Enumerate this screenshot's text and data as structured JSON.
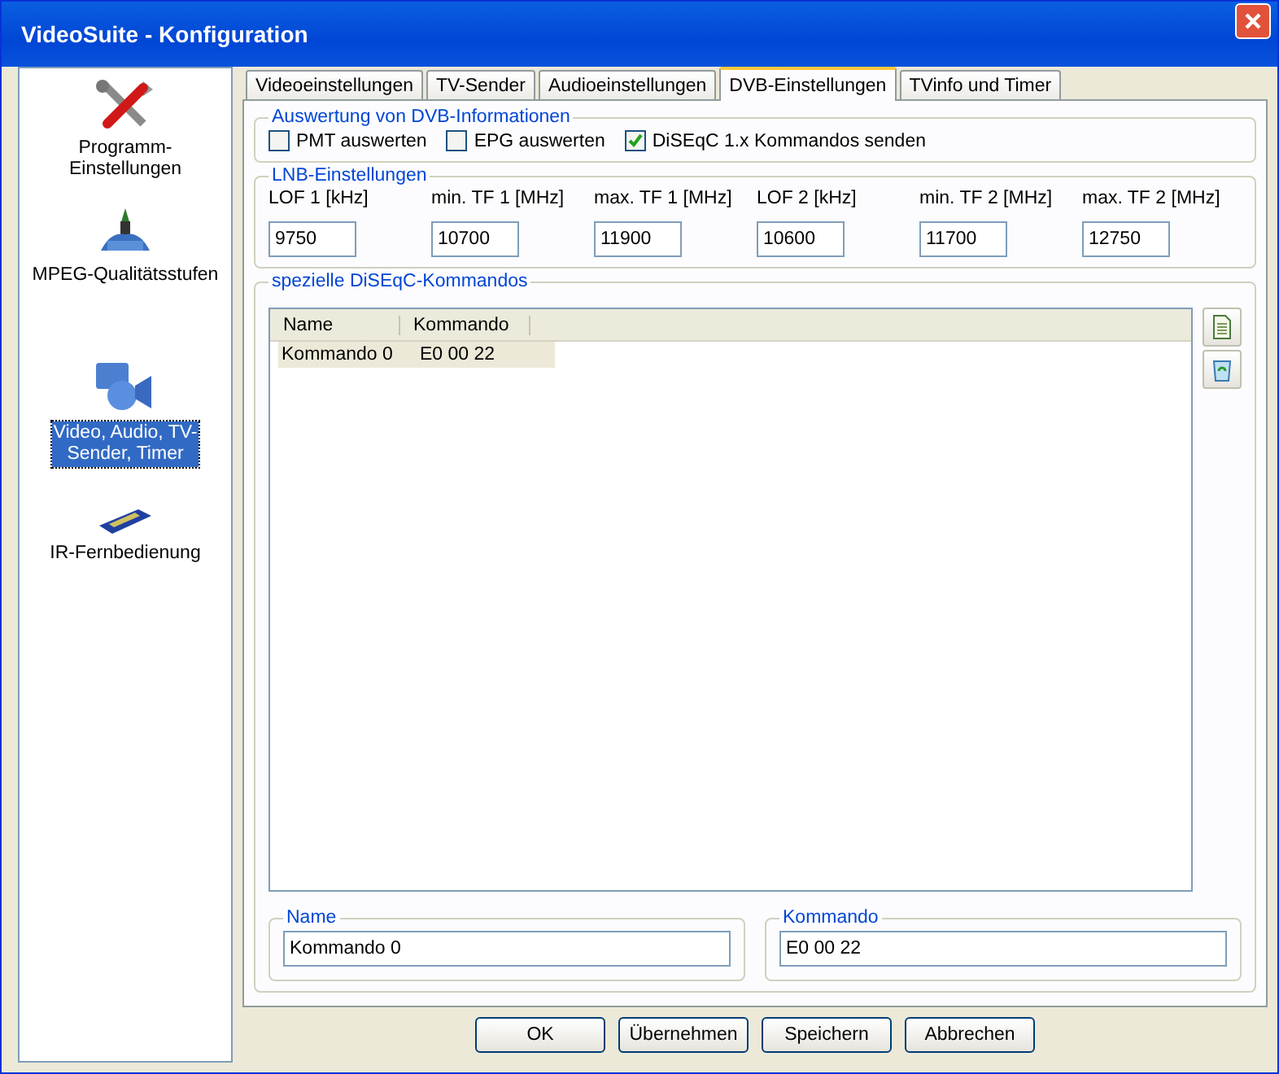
{
  "window": {
    "title": "VideoSuite - Konfiguration"
  },
  "sidebar": {
    "items": [
      {
        "label": "Programm-Einstellungen",
        "kind": "tools",
        "selected": false
      },
      {
        "label": "MPEG-Qualitätsstufen",
        "kind": "mpeg",
        "selected": false
      },
      {
        "label": "Video, Audio, TV-Sender, Timer",
        "kind": "media",
        "selected": true
      },
      {
        "label": "IR-Fernbedienung",
        "kind": "remote",
        "selected": false
      }
    ]
  },
  "tabs": [
    {
      "label": "Videoeinstellungen",
      "selected": false
    },
    {
      "label": "TV-Sender",
      "selected": false
    },
    {
      "label": "Audioeinstellungen",
      "selected": false
    },
    {
      "label": "DVB-Einstellungen",
      "selected": true
    },
    {
      "label": "TVinfo und Timer",
      "selected": false
    }
  ],
  "dvb_info": {
    "title": "Auswertung von DVB-Informationen",
    "checkboxes": [
      {
        "label": "PMT auswerten",
        "checked": false
      },
      {
        "label": "EPG auswerten",
        "checked": false
      },
      {
        "label": "DiSEqC 1.x Kommandos senden",
        "checked": true
      }
    ]
  },
  "lnb": {
    "title": "LNB-Einstellungen",
    "fields": [
      {
        "label": "LOF 1 [kHz]",
        "value": "9750"
      },
      {
        "label": "min. TF 1 [MHz]",
        "value": "10700"
      },
      {
        "label": "max. TF 1 [MHz]",
        "value": "11900"
      },
      {
        "label": "LOF 2 [kHz]",
        "value": "10600"
      },
      {
        "label": "min. TF 2 [MHz]",
        "value": "11700"
      },
      {
        "label": "max. TF 2 [MHz]",
        "value": "12750"
      }
    ]
  },
  "diseqc": {
    "title": "spezielle DiSEqC-Kommandos",
    "columns": [
      "Name",
      "Kommando"
    ],
    "rows": [
      {
        "cells": [
          "Kommando 0",
          "E0 00 22"
        ],
        "selected": true
      }
    ],
    "name_box": {
      "title": "Name",
      "value": "Kommando 0"
    },
    "command_box": {
      "title": "Kommando",
      "value": "E0 00 22"
    }
  },
  "buttons": [
    "OK",
    "Übernehmen",
    "Speichern",
    "Abbrechen"
  ]
}
